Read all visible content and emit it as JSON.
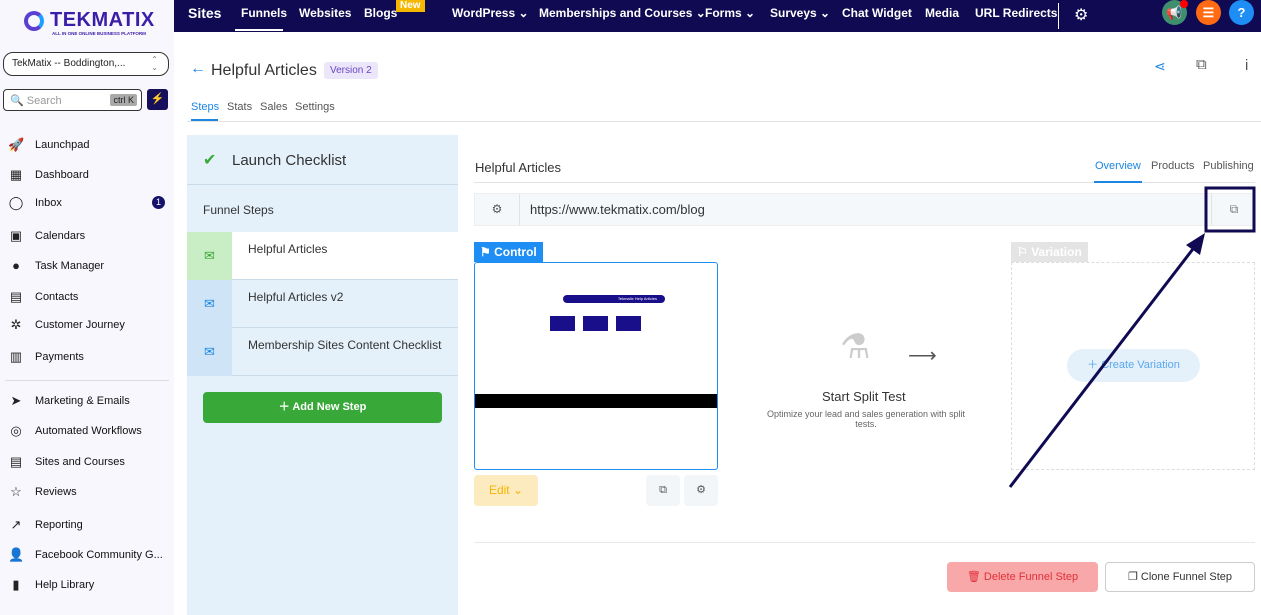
{
  "brand": {
    "name": "TEKMATIX",
    "tagline": "ALL IN ONE ONLINE BUSINESS PLATFORM"
  },
  "account": "TekMatix -- Boddington,...",
  "search": {
    "placeholder": "Search",
    "shortcut": "ctrl K"
  },
  "sidebar": [
    {
      "label": "Launchpad",
      "icon": "rocket-icon"
    },
    {
      "label": "Dashboard",
      "icon": "grid-icon"
    },
    {
      "label": "Inbox",
      "icon": "chat-icon",
      "badge": "1"
    },
    {
      "label": "Calendars",
      "icon": "calendar-icon"
    },
    {
      "label": "Task Manager",
      "icon": "check-circle-icon"
    },
    {
      "label": "Contacts",
      "icon": "contacts-icon"
    },
    {
      "label": "Customer Journey",
      "icon": "journey-icon"
    },
    {
      "label": "Payments",
      "icon": "payments-icon"
    },
    {
      "label": "Marketing & Emails",
      "icon": "send-icon"
    },
    {
      "label": "Automated Workflows",
      "icon": "workflow-icon"
    },
    {
      "label": "Sites and Courses",
      "icon": "sites-icon"
    },
    {
      "label": "Reviews",
      "icon": "star-icon"
    },
    {
      "label": "Reporting",
      "icon": "trend-icon"
    },
    {
      "label": "Facebook Community G...",
      "icon": "user-plus-icon"
    },
    {
      "label": "Help Library",
      "icon": "book-icon"
    }
  ],
  "topnav": {
    "title": "Sites",
    "items": [
      "Funnels",
      "Websites",
      "Blogs",
      "WordPress",
      "Memberships and Courses",
      "Forms",
      "Surveys",
      "Chat Widget",
      "Media",
      "URL Redirects"
    ],
    "new_badge": "New",
    "active": "Funnels"
  },
  "header": {
    "title": "Helpful Articles",
    "version": "Version 2",
    "tabs": [
      "Steps",
      "Stats",
      "Sales",
      "Settings"
    ]
  },
  "steps_panel": {
    "checklist": "Launch Checklist",
    "funnel_steps": "Funnel Steps",
    "steps": [
      "Helpful Articles",
      "Helpful Articles v2",
      "Membership Sites Content Checklist"
    ],
    "add_step": "Add New Step"
  },
  "step_detail": {
    "title": "Helpful Articles",
    "tabs": [
      "Overview",
      "Products",
      "Publishing"
    ],
    "url": "https://www.tekmatix.com/blog",
    "control": "Control",
    "variation": "Variation",
    "edit": "Edit",
    "split_title": "Start Split Test",
    "split_desc": "Optimize your lead and sales generation with split tests.",
    "create_variation": "Create Variation",
    "delete": "Delete Funnel Step",
    "clone": "Clone Funnel Step",
    "preview_title": "Tekmatix Help Articles"
  },
  "colors": {
    "navy": "#0f0a52",
    "accent": "#1c86e0",
    "green": "#38a838",
    "delete": "#f8a8a8"
  }
}
